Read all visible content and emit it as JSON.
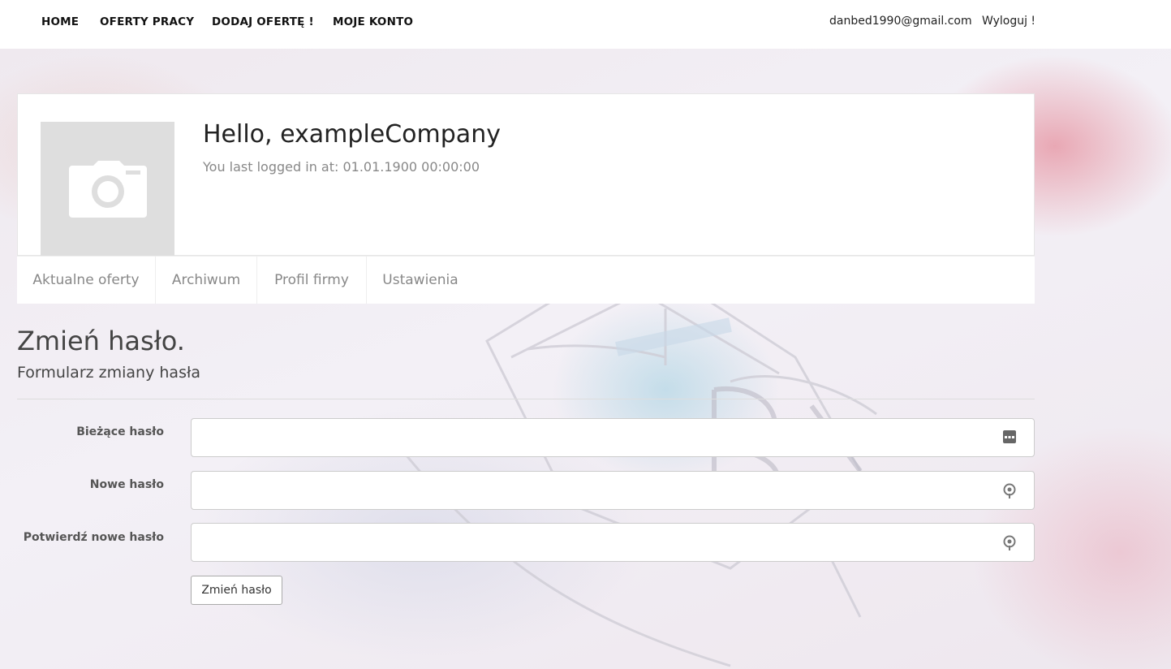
{
  "nav": {
    "home": "HOME",
    "offers": "OFERTY PRACY",
    "add_offer": "DODAJ OFERTĘ !",
    "my_account": "MOJE KONTO",
    "email": "danbed1990@gmail.com",
    "logout": "Wyloguj !"
  },
  "profile": {
    "greeting": "Hello, exampleCompany",
    "last_login": "You last logged in at: 01.01.1900 00:00:00",
    "avatar_icon": "camera-icon"
  },
  "tabs": [
    {
      "label": "Aktualne oferty"
    },
    {
      "label": "Archiwum"
    },
    {
      "label": "Profil firmy"
    },
    {
      "label": "Ustawienia"
    }
  ],
  "form": {
    "title": "Zmień hasło.",
    "subtitle": "Formularz zmiany hasła",
    "fields": [
      {
        "label": "Bieżące hasło",
        "value": "",
        "icon": "password-dots-icon"
      },
      {
        "label": "Nowe hasło",
        "value": "",
        "icon": "key-icon"
      },
      {
        "label": "Potwierdź nowe hasło",
        "value": "",
        "icon": "key-icon"
      }
    ],
    "submit_label": "Zmień hasło"
  }
}
